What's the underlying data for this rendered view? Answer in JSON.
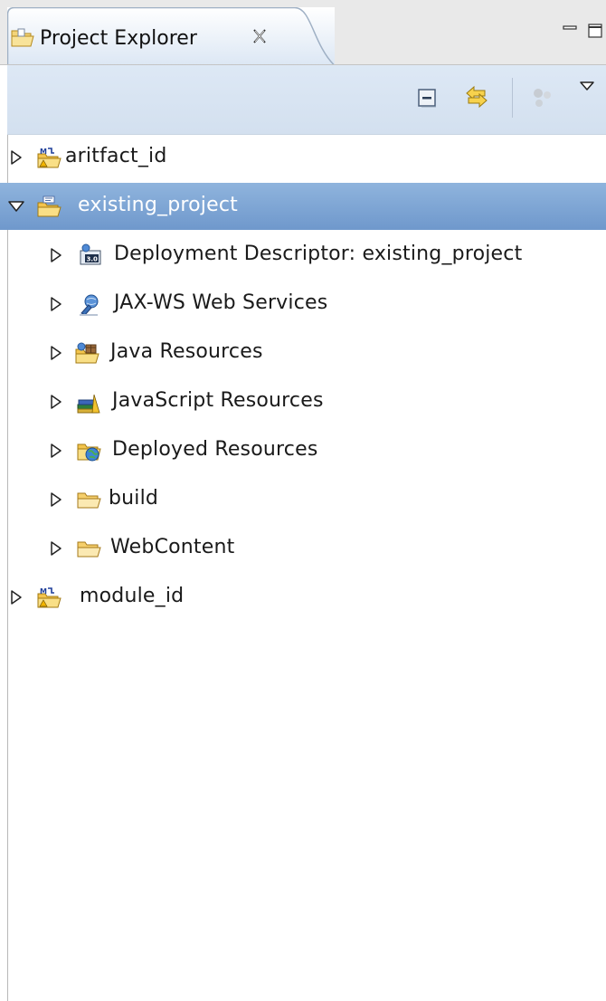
{
  "view": {
    "title": "Project Explorer",
    "tab_icon": "project-explorer-icon",
    "close_icon": "close-tab-icon",
    "window_controls": [
      "minimize-icon",
      "maximize-icon"
    ]
  },
  "toolbar": {
    "buttons": [
      "collapse-all-icon",
      "link-with-editor-icon",
      "focus-on-active-task-icon",
      "view-menu-icon"
    ]
  },
  "tree": {
    "items": [
      {
        "label": "aritfact_id",
        "level": 0,
        "expanded": false,
        "selected": false,
        "icon": "maven-project-icon"
      },
      {
        "label": "existing_project",
        "level": 0,
        "expanded": true,
        "selected": true,
        "icon": "web-project-icon"
      },
      {
        "label": "Deployment Descriptor: existing_project",
        "level": 1,
        "expanded": false,
        "icon": "deployment-descriptor-icon"
      },
      {
        "label": "JAX-WS Web Services",
        "level": 1,
        "expanded": false,
        "icon": "web-services-icon"
      },
      {
        "label": "Java Resources",
        "level": 1,
        "expanded": false,
        "icon": "java-resources-icon"
      },
      {
        "label": "JavaScript Resources",
        "level": 1,
        "expanded": false,
        "icon": "javascript-resources-icon"
      },
      {
        "label": "Deployed Resources",
        "level": 1,
        "expanded": false,
        "icon": "deployed-resources-icon"
      },
      {
        "label": "build",
        "level": 1,
        "expanded": false,
        "icon": "folder-icon"
      },
      {
        "label": "WebContent",
        "level": 1,
        "expanded": false,
        "icon": "folder-icon"
      },
      {
        "label": "module_id",
        "level": 0,
        "expanded": false,
        "selected": false,
        "icon": "maven-project-icon"
      }
    ]
  },
  "colors": {
    "selection": "#7aa2d2",
    "tab_gradient_bottom": "#dce7f4",
    "toolbar": "#d8e4f2",
    "folder": "#f0b23c"
  }
}
